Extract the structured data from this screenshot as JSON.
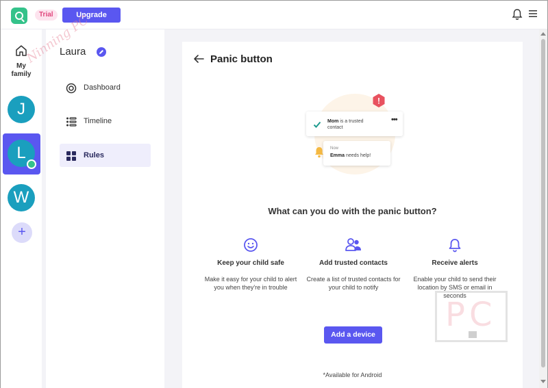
{
  "header": {
    "trial_label": "Trial",
    "upgrade_label": "Upgrade"
  },
  "rail": {
    "home_label": "My family",
    "children": [
      {
        "initial": "J"
      },
      {
        "initial": "L",
        "selected": true
      },
      {
        "initial": "W"
      }
    ],
    "add_label": "+"
  },
  "sidebar": {
    "child_name": "Laura",
    "items": [
      {
        "label": "Dashboard",
        "icon": "target-icon"
      },
      {
        "label": "Timeline",
        "icon": "timeline-icon"
      },
      {
        "label": "Rules",
        "icon": "grid-icon",
        "active": true
      }
    ]
  },
  "main": {
    "title": "Panic button",
    "illustration": {
      "card1_bold": "Mom",
      "card1_rest": " is a trusted",
      "card1_line2": "contact",
      "card1_menu": "•••",
      "card2_time": "Now",
      "card2_bold": "Emma",
      "card2_rest": " needs help!",
      "alert_mark": "!"
    },
    "question": "What can you do with the panic button?",
    "features": [
      {
        "icon": "smiley-icon",
        "title": "Keep your child safe",
        "desc": "Make it easy for your child to alert you when they're in trouble"
      },
      {
        "icon": "contacts-icon",
        "title": "Add trusted contacts",
        "desc": "Create a list of trusted contacts for your child to notify"
      },
      {
        "icon": "bell-icon",
        "title": "Receive alerts",
        "desc": "Enable your child to send their location by SMS or email in seconds"
      }
    ],
    "cta_label": "Add a device",
    "footnote": "*Available for Android"
  },
  "watermark": {
    "diag_text": "Ninning PC",
    "box_text": "PC"
  },
  "colors": {
    "accent": "#5a57f0",
    "brand_green": "#34c28a",
    "avatar_blue": "#1a9fbe",
    "trial_pink": "#e0467c"
  }
}
